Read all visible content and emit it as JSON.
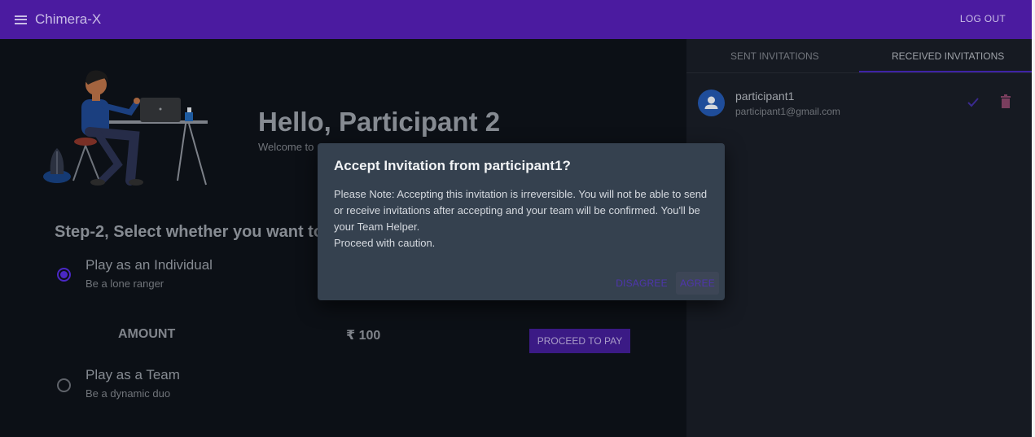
{
  "app": {
    "title": "Chimera-X",
    "logout_label": "LOG OUT"
  },
  "main": {
    "greeting": "Hello, Participant 2",
    "welcome": "Welcome to",
    "step_title": "Step-2, Select whether you want to",
    "options": [
      {
        "title": "Play as an Individual",
        "subtitle": "Be a lone ranger",
        "selected": true
      },
      {
        "title": "Play as a Team",
        "subtitle": "Be a dynamic duo",
        "selected": false
      }
    ],
    "amount_label": "AMOUNT",
    "amount_value": "₹ 100",
    "pay_button": "PROCEED TO PAY"
  },
  "invitations": {
    "tabs": [
      {
        "label": "SENT INVITATIONS",
        "active": false
      },
      {
        "label": "RECEIVED INVITATIONS",
        "active": true
      }
    ],
    "items": [
      {
        "name": "participant1",
        "email": "participant1@gmail.com",
        "avatar_icon": "person-icon",
        "actions": [
          "check-icon",
          "delete-icon"
        ]
      }
    ]
  },
  "dialog": {
    "title": "Accept Invitation from participant1?",
    "body_lines": [
      "Please Note: Accepting this invitation is irreversible. You will not be able to send or receive invitations after accepting and your team will be confirmed. You'll be your Team Helper.",
      "Proceed with caution."
    ],
    "disagree_label": "DISAGREE",
    "agree_label": "AGREE"
  },
  "colors": {
    "appbar": "#4b1ba0",
    "primary": "#4a28c4",
    "dialog_bg": "#35414f",
    "panel_bg": "#161a22",
    "main_bg": "#0c1016"
  }
}
